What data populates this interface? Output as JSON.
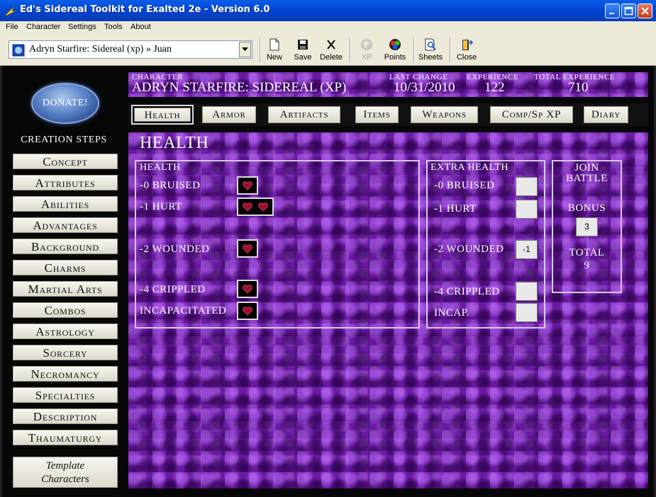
{
  "window": {
    "title": "Ed's Sidereal Toolkit for Exalted 2e - Version 6.0"
  },
  "menu": [
    "File",
    "Character",
    "Settings",
    "Tools",
    "About"
  ],
  "character_select": {
    "value": "Adryn Starfire: Sidereal (xp) » Juan"
  },
  "toolbar": {
    "new": "New",
    "save": "Save",
    "delete": "Delete",
    "xp": "XP",
    "points": "Points",
    "sheets": "Sheets",
    "close": "Close"
  },
  "donate": "DONATE!",
  "creation_steps": {
    "title": "CREATION STEPS",
    "items": [
      "Concept",
      "Attributes",
      "Abilities",
      "Advantages",
      "Background",
      "Charms",
      "Martial Arts",
      "Combos",
      "Astrology",
      "Sorcery",
      "Necromancy",
      "Specialties",
      "Description",
      "Thaumaturgy"
    ]
  },
  "template_button": {
    "line1": "Template",
    "line2": "Characters"
  },
  "header": {
    "character_label": "CHARACTER",
    "character_value": "ADRYN STARFIRE: SIDEREAL (XP)",
    "last_change_label": "LAST CHANGE",
    "last_change_value": "10/31/2010",
    "experience_label": "EXPERIENCE",
    "experience_value": "122",
    "total_exp_label": "TOTAL EXPERIENCE",
    "total_exp_value": "710"
  },
  "tabs": [
    "Health",
    "Armor",
    "Artifacts",
    "Items",
    "Weapons",
    "Comp/Sp XP",
    "Diary"
  ],
  "page_title": "HEALTH",
  "health": {
    "title": "HEALTH",
    "levels": [
      {
        "label": "-0 BRUISED",
        "hearts": 1
      },
      {
        "label": "-1 HURT",
        "hearts": 2
      },
      {
        "label": "-2 WOUNDED",
        "hearts": 1
      },
      {
        "label": "-4 CRIPPLED",
        "hearts": 1
      },
      {
        "label": "INCAPACITATED",
        "hearts": 1
      }
    ]
  },
  "extra_health": {
    "title": "EXTRA HEALTH",
    "levels": [
      {
        "label": "-0 BRUISED",
        "value": ""
      },
      {
        "label": "-1 HURT",
        "value": ""
      },
      {
        "label": "-2 WOUNDED",
        "value": "-1"
      },
      {
        "label": "-4 CRIPPLED",
        "value": ""
      },
      {
        "label": "INCAP.",
        "value": ""
      }
    ]
  },
  "join_battle": {
    "title_line1": "JOIN",
    "title_line2": "BATTLE",
    "bonus_label": "BONUS",
    "bonus_value": "3",
    "total_label": "TOTAL",
    "total_value": "9"
  },
  "colors": {
    "titlebar": "#0548d6",
    "purple": "#6a1ba3",
    "heart": "#9b0f2e"
  }
}
